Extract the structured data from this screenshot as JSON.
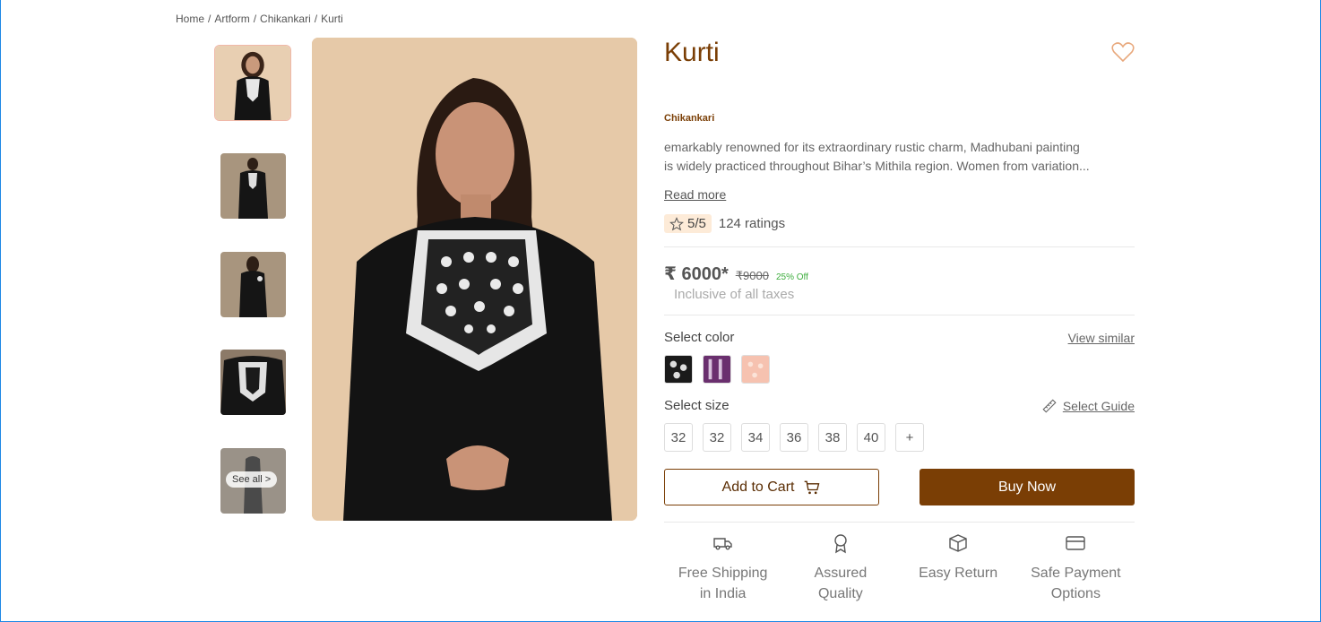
{
  "breadcrumb": {
    "items": [
      "Home",
      "Artform",
      "Chikankari",
      "Kurti"
    ],
    "separator": "/"
  },
  "gallery": {
    "see_all_label": "See all >",
    "thumbnails": [
      "thumb-front",
      "thumb-full",
      "thumb-back",
      "thumb-detail",
      "thumb-see-all"
    ]
  },
  "product": {
    "title": "Kurti",
    "artform": "Chikankari",
    "description_line1": "emarkably renowned for its extraordinary rustic charm, Madhubani painting",
    "description_line2": "is widely practiced throughout Bihar’s Mithila region. Women from variation...",
    "read_more": "Read more",
    "rating": "5/5",
    "rating_count": "124 ratings",
    "price": "₹ 6000*",
    "mrp": "₹9000",
    "discount": "25% Off",
    "tax_note": "Inclusive of all taxes"
  },
  "color": {
    "label": "Select color",
    "link": "View similar",
    "swatches": [
      "black",
      "purple",
      "peach"
    ]
  },
  "size": {
    "label": "Select size",
    "guide_link": "Select Guide",
    "options": [
      "32",
      "32",
      "34",
      "36",
      "38",
      "40",
      "+"
    ]
  },
  "actions": {
    "add_to_cart": "Add to Cart",
    "buy_now": "Buy Now"
  },
  "features": [
    {
      "line1": "Free Shipping",
      "line2": "in India",
      "icon": "truck-icon"
    },
    {
      "line1": "Assured",
      "line2": "Quality",
      "icon": "award-icon"
    },
    {
      "line1": "Easy Return",
      "line2": "",
      "icon": "box-icon"
    },
    {
      "line1": "Safe Payment",
      "line2": "Options",
      "icon": "card-icon"
    }
  ],
  "colors": {
    "brand": "#7a3e05",
    "discount": "#3fae3f",
    "rating_bg": "#fdebd8"
  }
}
